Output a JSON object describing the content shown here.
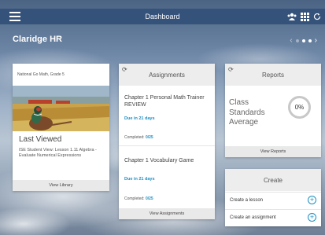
{
  "header": {
    "title": "Dashboard",
    "icons": [
      "menu-icon",
      "users-icon",
      "grid-icon",
      "refresh-icon"
    ]
  },
  "org_name": "Claridge HR",
  "pager": {
    "active_index": 1,
    "count": 3
  },
  "last_viewed": {
    "course": "National Go Math, Grade 5",
    "title": "Last Viewed",
    "description": "ISE Student View: Lesson 1.11 Algebra - Evaluate Numerical Expressions",
    "footer": "View Library"
  },
  "assignments": {
    "title": "Assignments",
    "items": [
      {
        "title": "Chapter 1 Personal Math Trainer REVIEW",
        "due": "Due in 21 days",
        "completed_label": "Completed:",
        "completed_value": "0/25"
      },
      {
        "title": "Chapter 1 Vocabulary Game",
        "due": "Due in 21 days",
        "completed_label": "Completed:",
        "completed_value": "0/25"
      }
    ],
    "footer": "View Assignments"
  },
  "reports": {
    "title": "Reports",
    "label": "Class Standards Average",
    "percent": "0%",
    "footer": "View Reports"
  },
  "create": {
    "title": "Create",
    "items": [
      {
        "label": "Create a lesson"
      },
      {
        "label": "Create an assignment"
      }
    ]
  },
  "colors": {
    "topbar": "#35527a",
    "accent": "#1b8ec2"
  }
}
